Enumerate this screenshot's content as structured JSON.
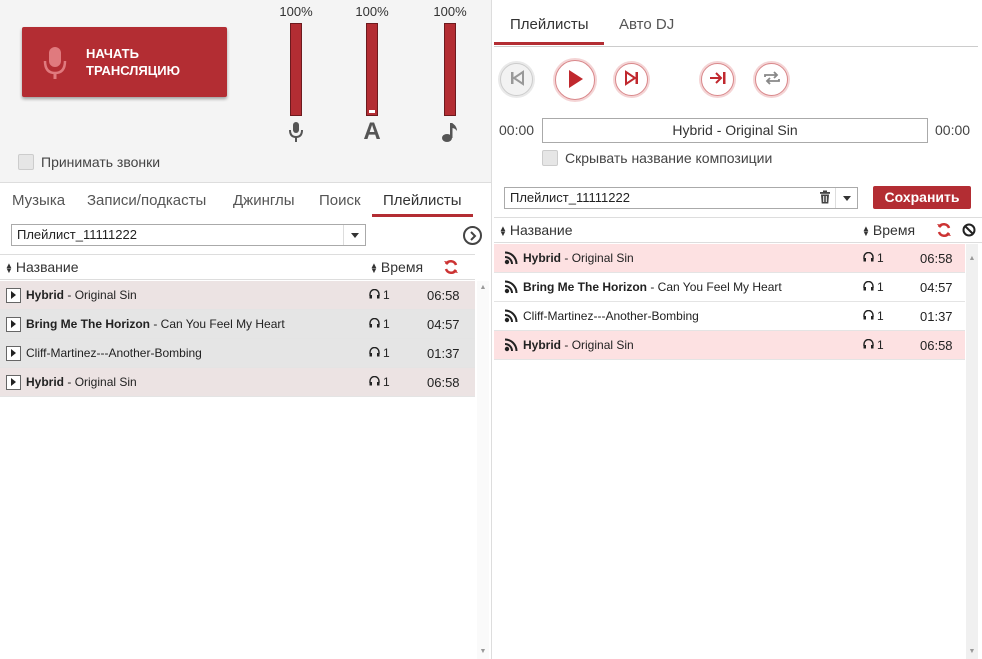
{
  "broadcast": {
    "label": "Начать\nтрансляцию"
  },
  "meters": [
    {
      "percent": "100%",
      "icon": "microphone-icon"
    },
    {
      "percent": "100%",
      "icon": "letter-a-icon"
    },
    {
      "percent": "100%",
      "icon": "music-note-icon"
    }
  ],
  "accept_calls": "Принимать звонки",
  "left_tabs": [
    "Музыка",
    "Записи/подкасты",
    "Джинглы",
    "Поиск",
    "Плейлисты"
  ],
  "left_active_tab": "Плейлисты",
  "left_playlist_select": "Плейлист_11111222",
  "columns": {
    "name": "Название",
    "time": "Время"
  },
  "left_tracks": [
    {
      "artist": "Hybrid",
      "sep": " - ",
      "title": "Original Sin",
      "listens": "1",
      "duration": "06:58"
    },
    {
      "artist": "Bring Me The Horizon",
      "sep": " - ",
      "title": "Can You Feel My Heart",
      "listens": "1",
      "duration": "04:57"
    },
    {
      "artist": "",
      "sep": "",
      "title": "Cliff-Martinez---Another-Bombing",
      "listens": "1",
      "duration": "01:37"
    },
    {
      "artist": "Hybrid",
      "sep": " - ",
      "title": "Original Sin",
      "listens": "1",
      "duration": "06:58"
    }
  ],
  "right_tabs": [
    "Плейлисты",
    "Авто DJ"
  ],
  "right_active_tab": "Плейлисты",
  "player": {
    "time_elapsed": "00:00",
    "now_playing": "Hybrid - Original Sin",
    "time_total": "00:00",
    "hide_name": "Скрывать название композиции"
  },
  "right_playlist_select": "Плейлист_11111222",
  "save_label": "Сохранить",
  "right_tracks": [
    {
      "artist": "Hybrid",
      "sep": " - ",
      "title": "Original Sin",
      "listens": "1",
      "duration": "06:58"
    },
    {
      "artist": "Bring Me The Horizon",
      "sep": " - ",
      "title": "Can You Feel My Heart",
      "listens": "1",
      "duration": "04:57"
    },
    {
      "artist": "",
      "sep": "",
      "title": "Cliff-Martinez---Another-Bombing",
      "listens": "1",
      "duration": "01:37"
    },
    {
      "artist": "Hybrid",
      "sep": " - ",
      "title": "Original Sin",
      "listens": "1",
      "duration": "06:58"
    }
  ],
  "colors": {
    "accent": "#b32d33",
    "row_highlight_left": "#ece3e3",
    "row_plain_left": "#e5e5e5",
    "row_highlight_right": "#fde1e2"
  }
}
